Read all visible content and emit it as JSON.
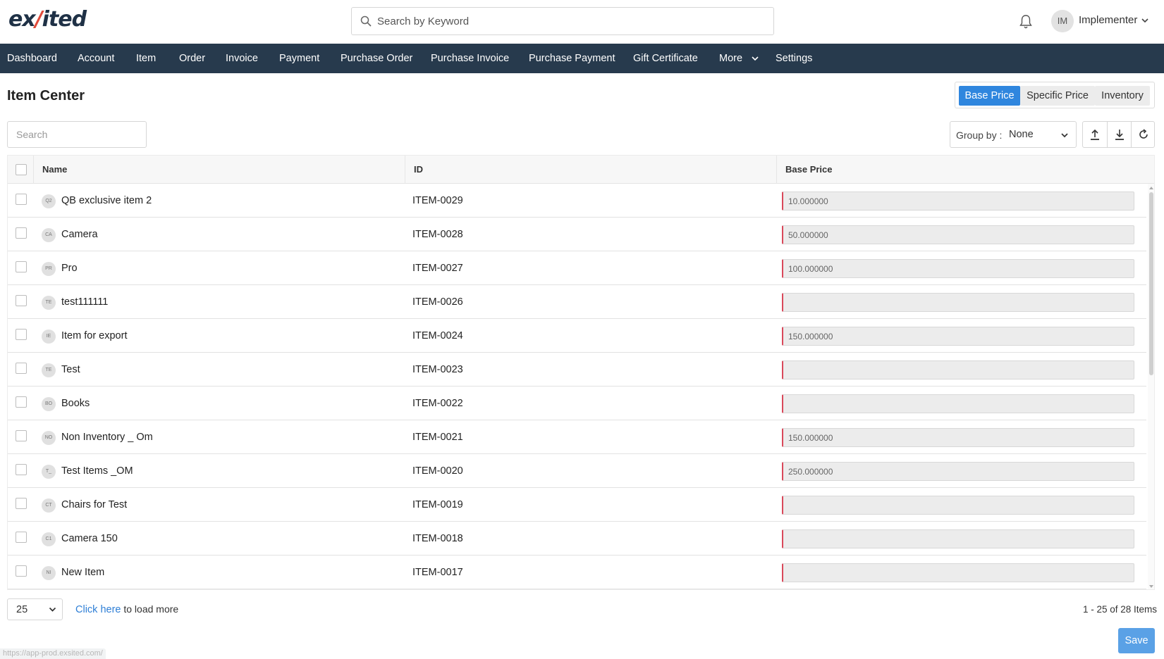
{
  "app": {
    "logo_prefix": "ex",
    "logo_accent": "/",
    "logo_suffix": "ited",
    "search_placeholder": "Search by Keyword",
    "user": {
      "initials": "IM",
      "name": "Implementer"
    },
    "colors": {
      "nav_bg": "#273a4d",
      "accent": "#2f86de",
      "logo_accent": "#e14b3b",
      "required_border": "#d9485a",
      "save_button": "#5aa1e6"
    }
  },
  "nav": {
    "items": [
      "Dashboard",
      "Account",
      "Item",
      "Order",
      "Invoice",
      "Payment",
      "Purchase Order",
      "Purchase Invoice",
      "Purchase Payment",
      "Gift Certificate",
      "More",
      "Settings"
    ]
  },
  "page": {
    "title": "Item Center",
    "tabs": [
      {
        "label": "Base Price",
        "active": true
      },
      {
        "label": "Specific Price",
        "active": false
      },
      {
        "label": "Inventory",
        "active": false
      }
    ],
    "search_placeholder": "Search",
    "group_by": {
      "label": "Group by :",
      "value": "None"
    }
  },
  "table": {
    "columns": [
      "Name",
      "ID",
      "Base Price"
    ],
    "rows": [
      {
        "initials": "Q2",
        "name": "QB exclusive item 2",
        "id": "ITEM-0029",
        "price": "10.000000"
      },
      {
        "initials": "CA",
        "name": "Camera",
        "id": "ITEM-0028",
        "price": "50.000000"
      },
      {
        "initials": "PR",
        "name": "Pro",
        "id": "ITEM-0027",
        "price": "100.000000"
      },
      {
        "initials": "TE",
        "name": "test111111",
        "id": "ITEM-0026",
        "price": ""
      },
      {
        "initials": "IE",
        "name": "Item for export",
        "id": "ITEM-0024",
        "price": "150.000000"
      },
      {
        "initials": "TE",
        "name": "Test",
        "id": "ITEM-0023",
        "price": ""
      },
      {
        "initials": "BO",
        "name": "Books",
        "id": "ITEM-0022",
        "price": ""
      },
      {
        "initials": "NO",
        "name": "Non Inventory _ Om",
        "id": "ITEM-0021",
        "price": "150.000000"
      },
      {
        "initials": "T_",
        "name": "Test Items _OM",
        "id": "ITEM-0020",
        "price": "250.000000"
      },
      {
        "initials": "CT",
        "name": "Chairs for Test",
        "id": "ITEM-0019",
        "price": ""
      },
      {
        "initials": "C1",
        "name": "Camera 150",
        "id": "ITEM-0018",
        "price": ""
      },
      {
        "initials": "NI",
        "name": "New Item",
        "id": "ITEM-0017",
        "price": ""
      }
    ]
  },
  "footer": {
    "page_size": "25",
    "load_more_link": "Click here",
    "load_more_text": " to load more",
    "count": "1 - 25 of 28 Items",
    "save_label": "Save",
    "status_url": "https://app-prod.exsited.com/"
  }
}
